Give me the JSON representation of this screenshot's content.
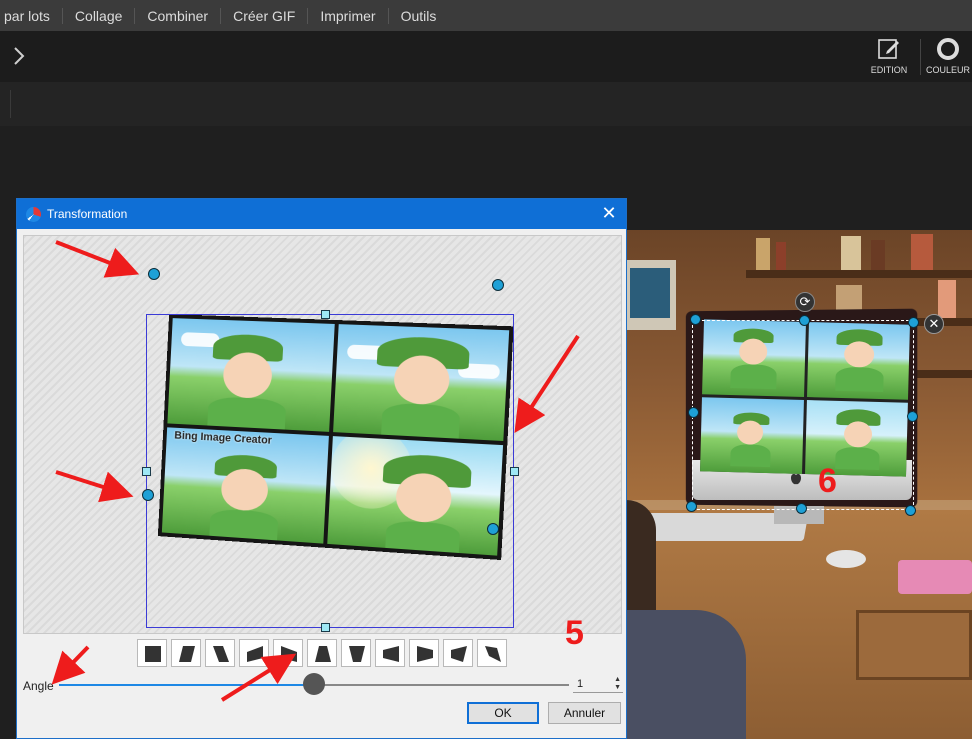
{
  "menubar": {
    "items": [
      "par lots",
      "Collage",
      "Combiner",
      "Créer GIF",
      "Imprimer",
      "Outils"
    ]
  },
  "toolbar": {
    "edition_label": "EDITION",
    "couleur_label": "COULEUR"
  },
  "dialog": {
    "title": "Transformation",
    "collage_caption": "Bing Image Creator",
    "angle_label": "Angle",
    "angle_value": "1",
    "angle_slider_level": 0.5,
    "ok_label": "OK",
    "cancel_label": "Annuler",
    "preset_icons": [
      "square-icon",
      "skew-right-icon",
      "skew-left-icon",
      "perspective-right-icon",
      "perspective-left-icon",
      "trapezoid-up-icon",
      "trapezoid-down-icon",
      "taper-left-icon",
      "taper-right-icon",
      "parallelogram-icon",
      "parallelogram-reverse-icon"
    ]
  },
  "annotations": {
    "label_5": "5",
    "label_6": "6",
    "arrow_color": "#ee1c1c"
  },
  "colors": {
    "accent": "#0f6fd6",
    "handle": "#1ea0d6"
  }
}
